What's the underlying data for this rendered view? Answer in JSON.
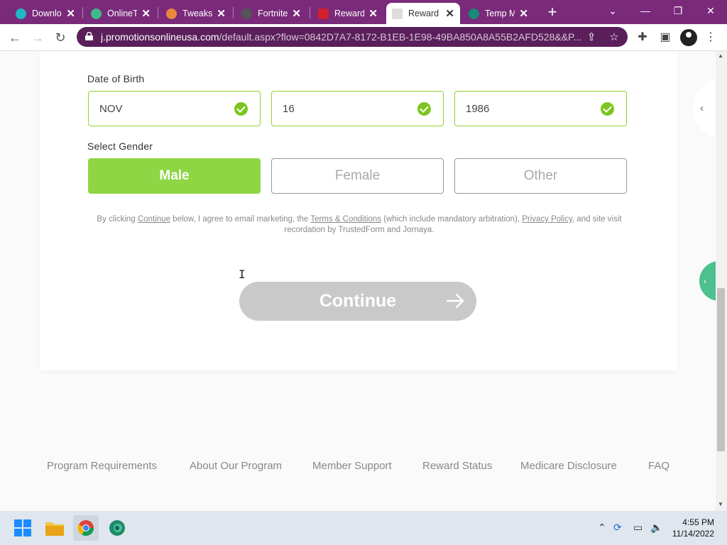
{
  "browser": {
    "tabs": [
      {
        "title": "Downlo",
        "fav_color": "#1fb6c8"
      },
      {
        "title": "OnlineT",
        "fav_color": "#3fb98a"
      },
      {
        "title": "Tweaks",
        "fav_color": "#e9883c"
      },
      {
        "title": "Fortnite",
        "fav_color": "#555555"
      },
      {
        "title": "Reward",
        "fav_color": "#d3202f"
      },
      {
        "title": "Reward",
        "fav_color": "#bbbbbb"
      },
      {
        "title": "Temp M",
        "fav_color": "#1a8a7a"
      }
    ],
    "active_tab_index": 5,
    "url_domain": "j.promotionsonlineusa.com",
    "url_path": "/default.aspx?flow=0842D7A7-8172-B1EB-1E98-49BA850A8A55B2AFD528&&P..."
  },
  "form": {
    "field_top_label": "",
    "dob_label": "Date of Birth",
    "dob": {
      "month": "NOV",
      "day": "16",
      "year": "1986"
    },
    "gender_label": "Select Gender",
    "gender_options": [
      "Male",
      "Female",
      "Other"
    ],
    "gender_selected": "Male",
    "legal": {
      "p1": "By clicking ",
      "continue_link": "Continue",
      "p2": " below, I agree to email marketing, the ",
      "terms_link": "Terms & Conditions",
      "p3": " (which include mandatory arbitration), ",
      "privacy_link": "Privacy Policy",
      "p4": ", and site visit recordation by TrustedForm and Jornaya."
    },
    "continue_label": "Continue"
  },
  "footer": {
    "links": [
      "Program Requirements",
      "About Our Program",
      "Member Support",
      "Reward Status",
      "Medicare Disclosure",
      "FAQ"
    ]
  },
  "taskbar": {
    "time": "4:55 PM",
    "date": "11/14/2022"
  },
  "colors": {
    "accent_green": "#8ed644",
    "check_green": "#7cc520",
    "browser_frame": "#7a2a7a"
  }
}
